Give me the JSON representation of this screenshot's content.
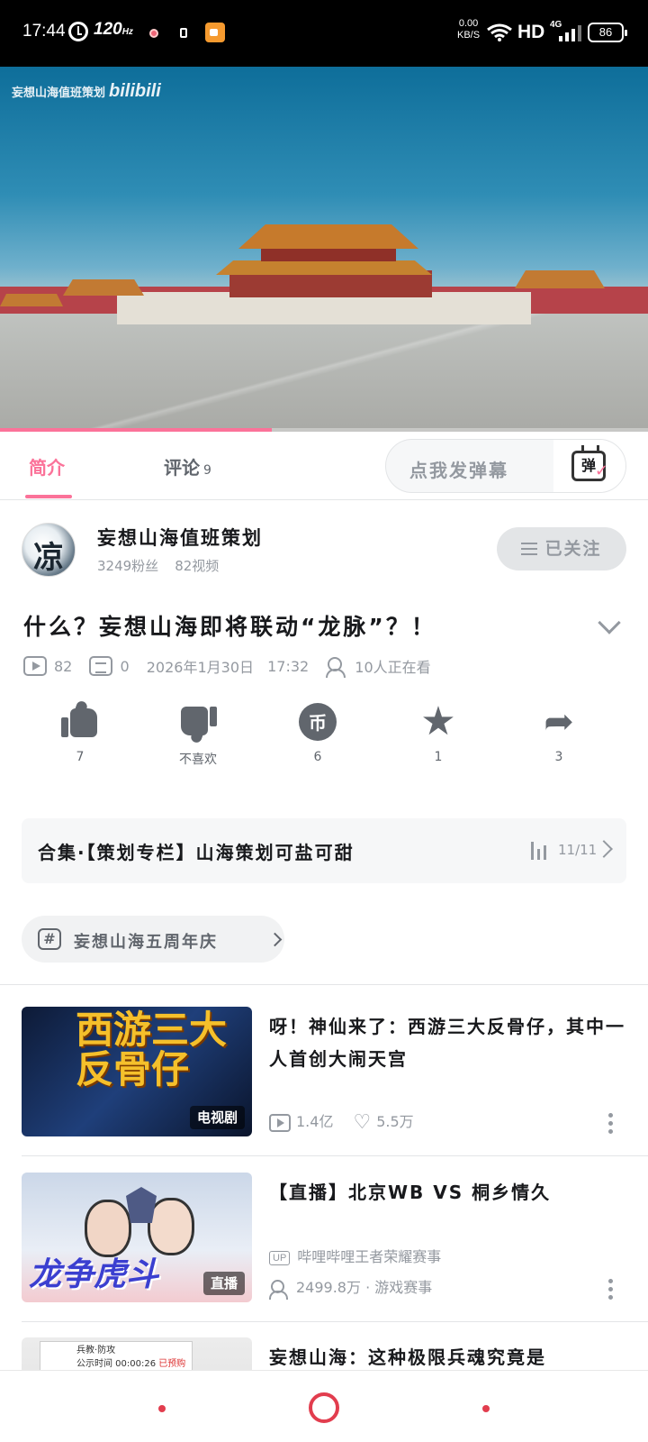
{
  "status_bar": {
    "time": "17:44",
    "refresh_rate": "120",
    "refresh_unit": "Hz",
    "net_speed_value": "0.00",
    "net_speed_unit": "KB/S",
    "hd_label": "HD",
    "network_type": "4G",
    "battery": "86"
  },
  "video": {
    "watermark": "妄想山海值班策划",
    "watermark_brand": "bilibili",
    "progress": 0.42
  },
  "tabs": {
    "intro": "简介",
    "comments": "评论",
    "comments_count": "9",
    "danmaku_placeholder": "点我发弹幕",
    "danmaku_icon_char": "弹"
  },
  "uploader": {
    "avatar_char": "凉",
    "name": "妄想山海值班策划",
    "fans": "3249粉丝",
    "videos": "82视频",
    "follow_label": "已关注"
  },
  "video_info": {
    "title": "什么？妄想山海即将联动“龙脉”？！",
    "plays": "82",
    "danmaku": "0",
    "date": "2026年1月30日",
    "time": "17:32",
    "watching": "10人正在看"
  },
  "actions": {
    "like": "7",
    "dislike": "不喜欢",
    "coin": "6",
    "coin_glyph": "币",
    "favorite": "1",
    "share": "3"
  },
  "collection": {
    "title": "合集·【策划专栏】山海策划可盐可甜",
    "count": "11/11"
  },
  "topic": {
    "hash": "#",
    "label": "妄想山海五周年庆"
  },
  "related": [
    {
      "title": "呀！神仙来了：西游三大反骨仔，其中一人首创大闹天宫",
      "thumb_text": "西游三大反骨仔",
      "badge": "电视剧",
      "views": "1.4亿",
      "likes": "5.5万"
    },
    {
      "title": "【直播】北京WB VS 桐乡情久",
      "thumb_text": "龙争虎斗",
      "badge": "直播",
      "up_tag": "UP",
      "channel": "哔哩哔哩王者荣耀赛事",
      "watching": "2499.8万",
      "category": "游戏赛事"
    },
    {
      "title": "妄想山海：这种极限兵魂究竟是",
      "thumb_panel_line1": "兵教·防攻",
      "thumb_panel_line2": "公示时间 00:00:26",
      "thumb_panel_tag": "已预购"
    }
  ]
}
